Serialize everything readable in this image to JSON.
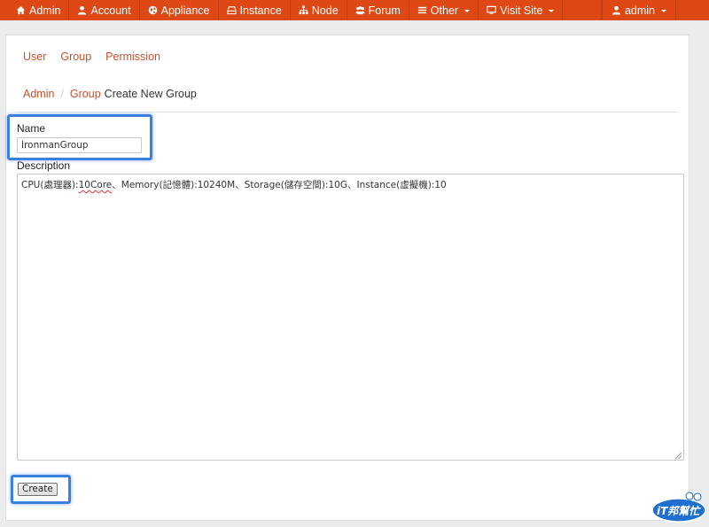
{
  "nav": {
    "items": [
      {
        "label": "Admin",
        "icon": "home-icon",
        "dropdown": false
      },
      {
        "label": "Account",
        "icon": "user-icon",
        "dropdown": false
      },
      {
        "label": "Appliance",
        "icon": "globe-icon",
        "dropdown": false
      },
      {
        "label": "Instance",
        "icon": "hdd-icon",
        "dropdown": false
      },
      {
        "label": "Node",
        "icon": "sitemap-icon",
        "dropdown": false
      },
      {
        "label": "Forum",
        "icon": "group-icon",
        "dropdown": false
      },
      {
        "label": "Other",
        "icon": "list-icon",
        "dropdown": true
      },
      {
        "label": "Visit Site",
        "icon": "monitor-icon",
        "dropdown": true
      }
    ],
    "user": {
      "label": "admin",
      "icon": "user-icon"
    }
  },
  "colors": {
    "navbar": "#dd4814",
    "link": "#c8502c",
    "highlight": "#3b7fe0"
  },
  "subnav": {
    "user": "User",
    "group": "Group",
    "permission": "Permission"
  },
  "breadcrumb": {
    "admin": "Admin",
    "separator": "/",
    "group": "Group",
    "current": "Create New Group"
  },
  "form": {
    "name_label": "Name",
    "name_value": "IronmanGroup",
    "description_label": "Description",
    "description_prefix": "CPU(處理器):",
    "description_flagged": "10Core",
    "description_suffix": "、Memory(記憶體):10240M、Storage(儲存空間):10G、Instance(虛擬機):10",
    "create_label": "Create"
  },
  "watermark": {
    "text": "iT邦幫忙"
  }
}
